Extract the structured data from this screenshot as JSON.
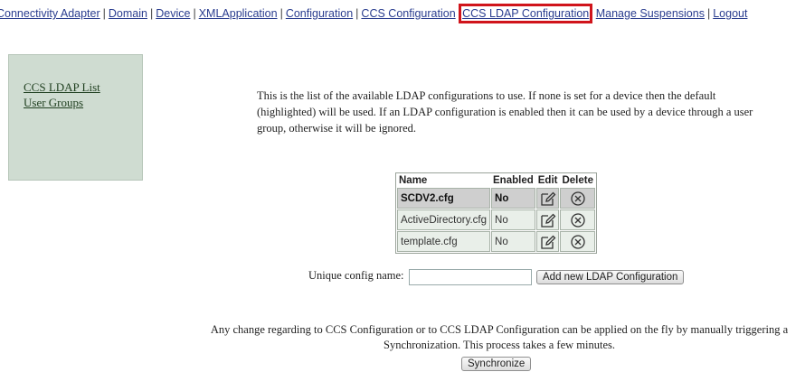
{
  "nav": {
    "items": [
      {
        "label": "Connectivity Adapter"
      },
      {
        "label": "Domain"
      },
      {
        "label": "Device"
      },
      {
        "label": "XMLApplication"
      },
      {
        "label": "Configuration"
      },
      {
        "label": "CCS Configuration"
      },
      {
        "label": "CCS LDAP Configuration"
      },
      {
        "label": "Manage Suspensions"
      },
      {
        "label": "Logout"
      }
    ],
    "separator": "|",
    "active_item": "CCS LDAP Configuration",
    "highlight_color": "#d0141b"
  },
  "sidebar": {
    "links": [
      {
        "label": "CCS LDAP List"
      },
      {
        "label": "User Groups"
      }
    ]
  },
  "intro": {
    "text": "This is the list of the available LDAP configurations to use. If none is set for a device then the default (highlighted) will be used. If an LDAP configuration is enabled then it can be used by a device through a user group, otherwise it will be ignored."
  },
  "table": {
    "headers": {
      "name": "Name",
      "enabled": "Enabled",
      "edit": "Edit",
      "delete": "Delete"
    },
    "rows": [
      {
        "name": "SCDV2.cfg",
        "enabled": "No",
        "default": true
      },
      {
        "name": "ActiveDirectory.cfg",
        "enabled": "No",
        "default": false
      },
      {
        "name": "template.cfg",
        "enabled": "No",
        "default": false
      }
    ],
    "edit_icon": "edit-icon",
    "delete_icon": "delete-circle-x-icon"
  },
  "form": {
    "label": "Unique config name:",
    "value": "",
    "add_button": "Add new LDAP Configuration"
  },
  "note": {
    "text": "Any change regarding to CCS Configuration or to CCS LDAP Configuration can be applied on the fly by manually triggering a Synchronization. This process takes a few minutes.",
    "sync_button": "Synchronize"
  }
}
